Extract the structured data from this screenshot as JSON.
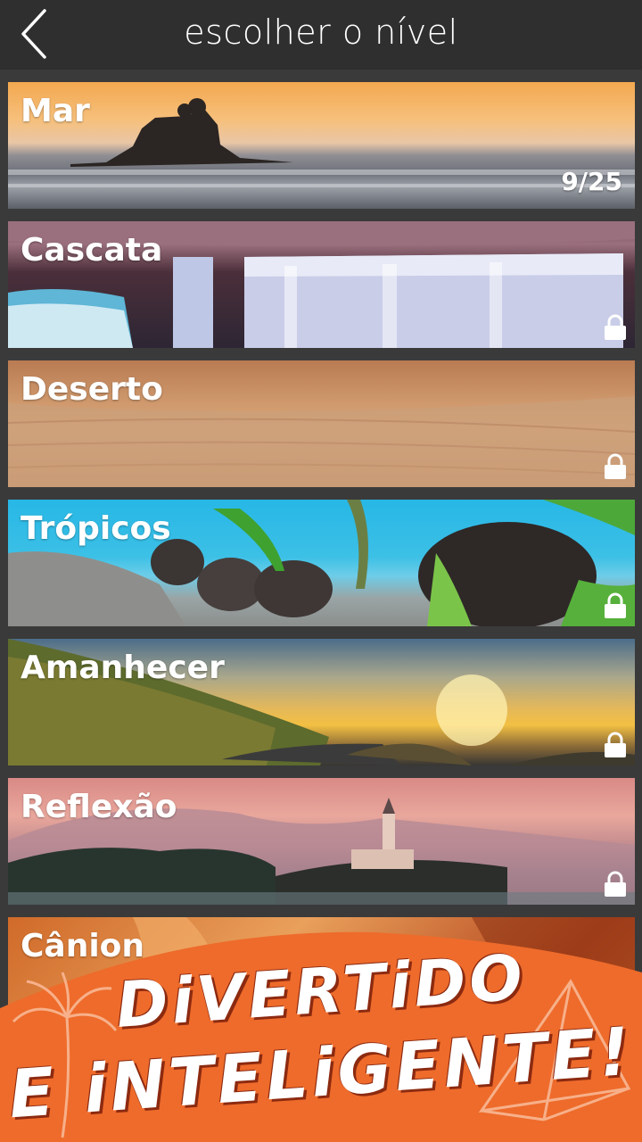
{
  "header": {
    "title": "escolher o nível",
    "back_icon": "chevron-left-icon"
  },
  "levels": [
    {
      "name": "Mar",
      "progress": "9/25",
      "locked": false
    },
    {
      "name": "Cascata",
      "locked": true
    },
    {
      "name": "Deserto",
      "locked": true
    },
    {
      "name": "Trópicos",
      "locked": true
    },
    {
      "name": "Amanhecer",
      "locked": true
    },
    {
      "name": "Reflexão",
      "locked": true
    },
    {
      "name": "Cânion",
      "locked": false
    }
  ],
  "banner": {
    "line1": "DiVERTiDO",
    "line2": "E iNTELiGENTE!",
    "color": "#ee6b2b"
  }
}
